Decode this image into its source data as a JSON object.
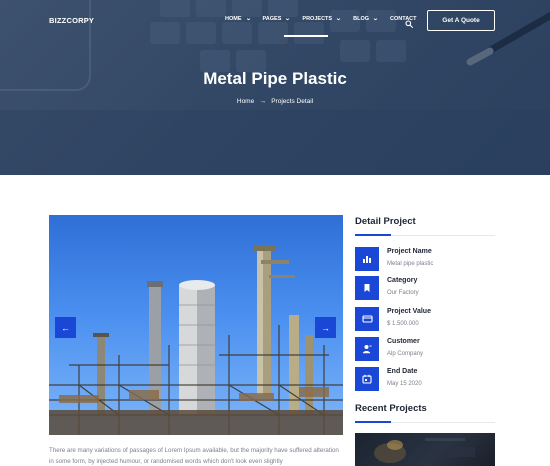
{
  "brand": {
    "logo": "BIZZCORPY"
  },
  "nav": {
    "items": [
      {
        "label": "HOME",
        "has_dropdown": true
      },
      {
        "label": "PAGES",
        "has_dropdown": true
      },
      {
        "label": "PROJECTS",
        "has_dropdown": true,
        "active": true
      },
      {
        "label": "BLOG",
        "has_dropdown": true
      },
      {
        "label": "CONTACT",
        "has_dropdown": false
      }
    ],
    "search_icon": "search-icon",
    "cta": "Get A Quote"
  },
  "hero": {
    "title": "Metal Pipe Plastic",
    "breadcrumb": {
      "home": "Home",
      "separator": "→",
      "current": "Projects Detail"
    }
  },
  "slider": {
    "prev": "←",
    "next": "→"
  },
  "description": "There are many variations of passages of Lorem Ipsum available, but the majority have suffered alteration in some form, by injected humour, or randomised words which don't look even slightly",
  "sidebar": {
    "detail_title": "Detail Project",
    "details": [
      {
        "icon": "chart-icon",
        "label": "Project Name",
        "value": "Metal pipe plastic"
      },
      {
        "icon": "bookmark-icon",
        "label": "Category",
        "value": "Our Factory"
      },
      {
        "icon": "wallet-icon",
        "label": "Project Value",
        "value": "$ 1.500.000"
      },
      {
        "icon": "user-icon",
        "label": "Customer",
        "value": "Alp Company"
      },
      {
        "icon": "calendar-icon",
        "label": "End Date",
        "value": "May 15 2020"
      }
    ],
    "recent_title": "Recent Projects"
  },
  "colors": {
    "accent": "#1a47d6",
    "hero_overlay": "#3e5470",
    "text_dark": "#1e2433",
    "text_muted": "#7a7f8a"
  }
}
